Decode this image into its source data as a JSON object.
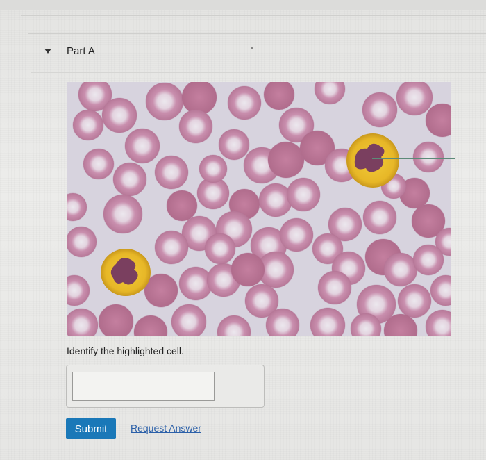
{
  "part": {
    "title": "Part A",
    "collapse_icon": "caret-down-icon"
  },
  "image": {
    "description_icon": "blood-smear-micrograph"
  },
  "question": {
    "prompt": "Identify the highlighted cell."
  },
  "answer": {
    "value": "",
    "placeholder": ""
  },
  "actions": {
    "submit_label": "Submit",
    "request_answer_label": "Request Answer"
  },
  "colors": {
    "submit_bg": "#1a78b8",
    "link": "#2a5fa8",
    "rbc": "#c98fae",
    "neutrophil_cytoplasm": "#e7b727",
    "neutrophil_nucleus": "#7a3f5f"
  }
}
